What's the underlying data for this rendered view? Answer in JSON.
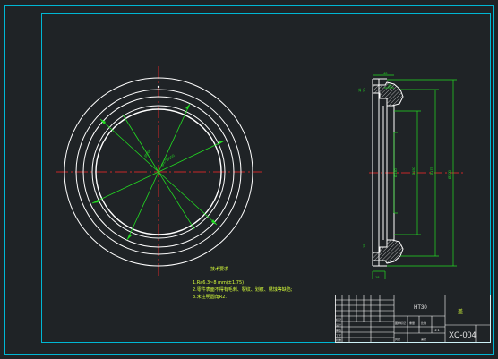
{
  "colors": {
    "background": "#1f2326",
    "frame": "#00b7d4",
    "outline": "#ffffff",
    "centerline": "#ff2a2a",
    "dimension": "#22dd22",
    "notes": "#d8ff3a",
    "hatch": "#cfcfcf",
    "title_text": "#e8e8e8"
  },
  "notes": {
    "heading": "技术要求",
    "line1": "1.Ra6.3~8 mm(±1.75)",
    "line2": "2.零件表面不得有毛刺、裂纹、划痕、锈蚀等缺陷;",
    "line3": "3.未注明圆角R2."
  },
  "title_block": {
    "material": "HT30",
    "part_name": "盖",
    "drawing_number": "XC-004",
    "scale": "1:1"
  }
}
